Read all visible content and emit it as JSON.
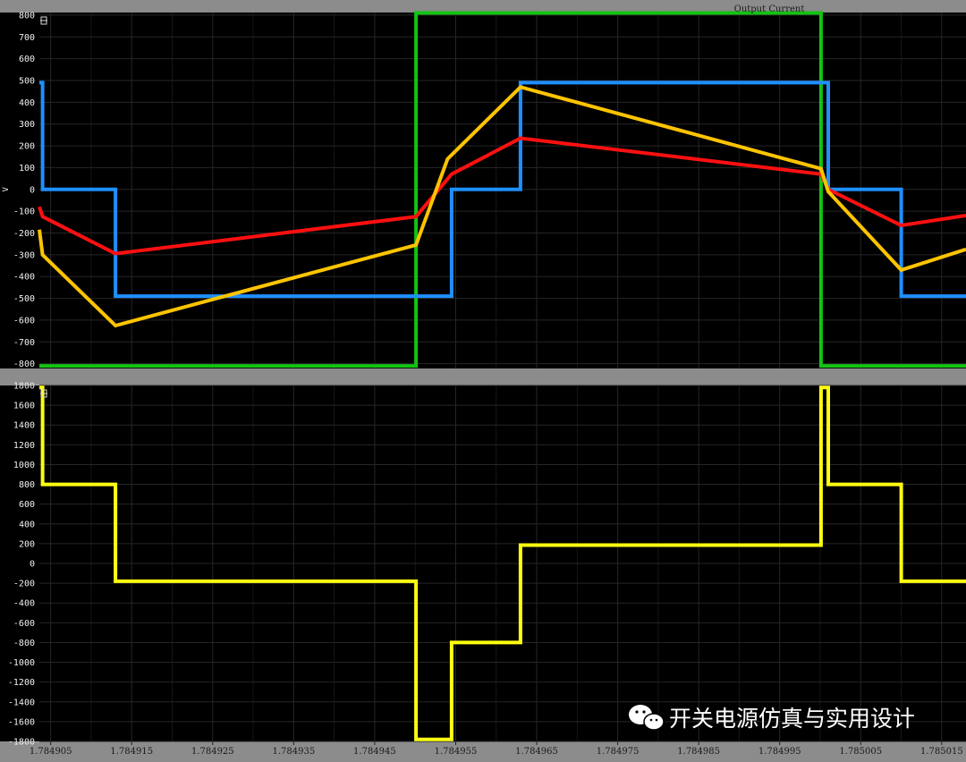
{
  "watermark": {
    "text": "开关电源仿真与实用设计",
    "icon": "wechat-icon"
  },
  "colors": {
    "background": "#000000",
    "frame": "#8c8c8c",
    "grid": "#1c1c1c",
    "blue": "#1e90ff",
    "red": "#ff1010",
    "orange": "#ffc400",
    "green": "#13c313",
    "yellow": "#ffff10"
  },
  "x_ticks": [
    "1.784905",
    "1.784915",
    "1.784925",
    "1.784935",
    "1.784945",
    "1.784955",
    "1.784965",
    "1.784975",
    "1.784985",
    "1.784995",
    "1.785005",
    "1.785015"
  ],
  "chart_data": [
    {
      "type": "line",
      "title": "Output Current",
      "ylabel": "V",
      "xlim": [
        1.7849036,
        1.785018
      ],
      "ylim": [
        -820,
        820
      ],
      "yticks": [
        -800,
        -700,
        -600,
        -500,
        -400,
        -300,
        -200,
        -100,
        0,
        100,
        200,
        300,
        400,
        500,
        600,
        700,
        800
      ],
      "grid": true,
      "series": [
        {
          "color": "#13c313",
          "points": [
            [
              1.7849036,
              -810
            ],
            [
              1.7849501,
              -810
            ],
            [
              1.7849501,
              810
            ],
            [
              1.7850001,
              810
            ],
            [
              1.7850001,
              -810
            ],
            [
              1.785018,
              -810
            ]
          ]
        },
        {
          "color": "#1e90ff",
          "points": [
            [
              1.7849036,
              490
            ],
            [
              1.784904,
              490
            ],
            [
              1.784904,
              0
            ],
            [
              1.784913,
              0
            ],
            [
              1.784913,
              -490
            ],
            [
              1.7849545,
              -490
            ],
            [
              1.7849545,
              0
            ],
            [
              1.784963,
              0
            ],
            [
              1.784963,
              490
            ],
            [
              1.785001,
              490
            ],
            [
              1.785001,
              0
            ],
            [
              1.78501,
              0
            ],
            [
              1.78501,
              -490
            ],
            [
              1.785018,
              -490
            ]
          ]
        },
        {
          "color": "#ff1010",
          "points": [
            [
              1.7849036,
              -80
            ],
            [
              1.784904,
              -125
            ],
            [
              1.784913,
              -295
            ],
            [
              1.7849501,
              -125
            ],
            [
              1.7849545,
              70
            ],
            [
              1.784963,
              235
            ],
            [
              1.7850001,
              70
            ],
            [
              1.785001,
              0
            ],
            [
              1.78501,
              -165
            ],
            [
              1.785018,
              -120
            ]
          ]
        },
        {
          "color": "#ffc400",
          "points": [
            [
              1.7849036,
              -185
            ],
            [
              1.784904,
              -300
            ],
            [
              1.784913,
              -625
            ],
            [
              1.7849501,
              -255
            ],
            [
              1.784954,
              140
            ],
            [
              1.784963,
              470
            ],
            [
              1.7850001,
              95
            ],
            [
              1.785001,
              -10
            ],
            [
              1.78501,
              -370
            ],
            [
              1.785018,
              -275
            ]
          ]
        }
      ]
    },
    {
      "type": "line",
      "title": "",
      "ylabel": "",
      "xlim": [
        1.7849036,
        1.785018
      ],
      "ylim": [
        -1800,
        1800
      ],
      "yticks": [
        -1800,
        -1600,
        -1400,
        -1200,
        -1000,
        -800,
        -600,
        -400,
        -200,
        0,
        200,
        400,
        600,
        800,
        1000,
        1200,
        1400,
        1600,
        1800
      ],
      "grid": true,
      "series": [
        {
          "color": "#ffff10",
          "points": [
            [
              1.7849036,
              1780
            ],
            [
              1.784904,
              1780
            ],
            [
              1.784904,
              800
            ],
            [
              1.784913,
              800
            ],
            [
              1.784913,
              -180
            ],
            [
              1.7849501,
              -180
            ],
            [
              1.7849501,
              -1780
            ],
            [
              1.7849545,
              -1780
            ],
            [
              1.7849545,
              -800
            ],
            [
              1.784963,
              -800
            ],
            [
              1.784963,
              185
            ],
            [
              1.7850001,
              185
            ],
            [
              1.7850001,
              1780
            ],
            [
              1.785001,
              1780
            ],
            [
              1.785001,
              800
            ],
            [
              1.78501,
              800
            ],
            [
              1.78501,
              -180
            ],
            [
              1.785018,
              -180
            ]
          ]
        }
      ]
    }
  ]
}
